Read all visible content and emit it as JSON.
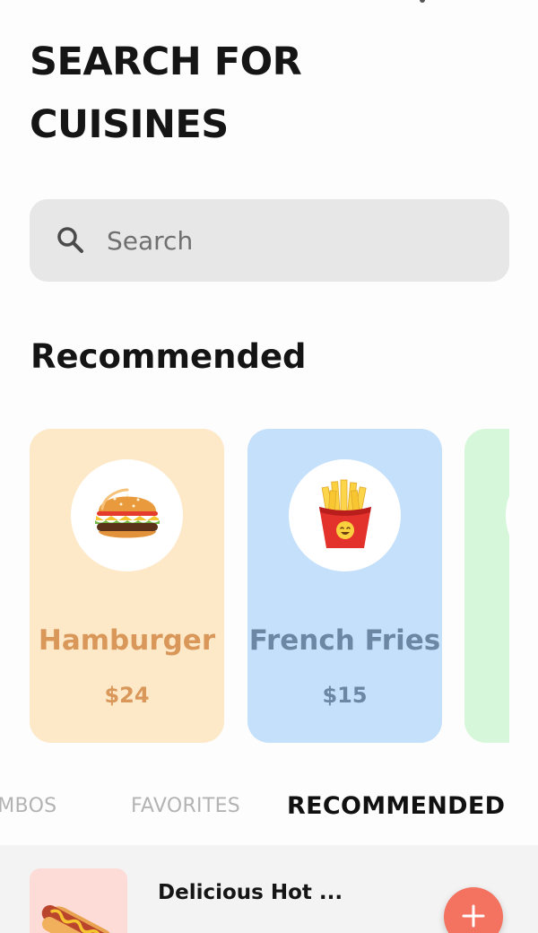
{
  "header": {
    "title_line1": "SEARCH FOR",
    "title_line2": "CUISINES"
  },
  "search": {
    "placeholder": "Search",
    "icon": "search-icon"
  },
  "recommended": {
    "section_title": "Recommended",
    "cards": [
      {
        "name": "Hamburger",
        "price": "$24",
        "icon": "hamburger-icon",
        "background": "#fde8c8",
        "text_color": "#d9975a"
      },
      {
        "name": "French Fries",
        "price": "$15",
        "icon": "french-fries-icon",
        "background": "#c5e0fb",
        "text_color": "#6b87a3"
      },
      {
        "name": "",
        "price": "",
        "icon": "",
        "background": "#d6f7d9",
        "text_color": "#5a9a62"
      }
    ]
  },
  "tabs": [
    {
      "label": "COMBOS",
      "active": false
    },
    {
      "label": "FAVORITES",
      "active": false
    },
    {
      "label": "RECOMMENDED",
      "active": true
    }
  ],
  "list": {
    "items": [
      {
        "title": "Delicious Hot ...",
        "icon": "hot-dog-icon",
        "thumb_background": "#fddcd8"
      }
    ],
    "add_button_icon": "plus-icon",
    "accent": "#f47260"
  }
}
